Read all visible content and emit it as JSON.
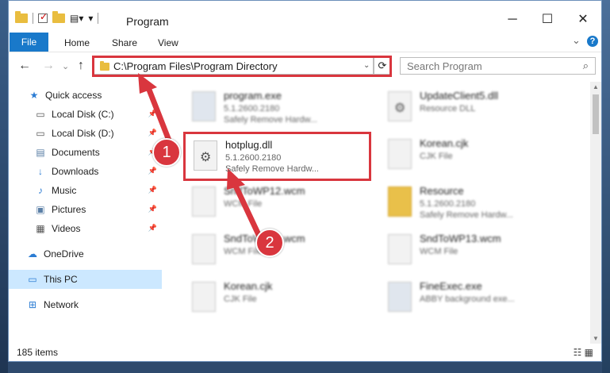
{
  "window": {
    "title": "Program",
    "min_label": "─",
    "max_label": "☐",
    "close_label": "✕"
  },
  "ribbon": {
    "file": "File",
    "home": "Home",
    "share": "Share",
    "view": "View",
    "expand": "⌄",
    "help": "?"
  },
  "address": {
    "path": "C:\\Program Files\\Program Directory",
    "search_placeholder": "Search Program",
    "back": "←",
    "forward": "→",
    "recent": "⌄",
    "up": "↑",
    "refresh": "⟳",
    "dropdown": "⌄",
    "search_icon": "⌕"
  },
  "sidebar": {
    "items": [
      {
        "label": "Quick access",
        "icon": "star-icon",
        "glyph": "★",
        "color": "#2b7cd3"
      },
      {
        "label": "Local Disk (C:)",
        "icon": "drive-icon",
        "glyph": "▭",
        "color": "#555555"
      },
      {
        "label": "Local Disk (D:)",
        "icon": "drive-icon",
        "glyph": "▭",
        "color": "#555555"
      },
      {
        "label": "Documents",
        "icon": "documents-icon",
        "glyph": "▤",
        "color": "#5b7fa6"
      },
      {
        "label": "Downloads",
        "icon": "download-icon",
        "glyph": "↓",
        "color": "#2b7cd3"
      },
      {
        "label": "Music",
        "icon": "music-icon",
        "glyph": "♪",
        "color": "#2b7cd3"
      },
      {
        "label": "Pictures",
        "icon": "pictures-icon",
        "glyph": "▣",
        "color": "#5b7fa6"
      },
      {
        "label": "Videos",
        "icon": "videos-icon",
        "glyph": "▦",
        "color": "#555555"
      },
      {
        "label": "OneDrive",
        "icon": "cloud-icon",
        "glyph": "☁",
        "color": "#2b7cd3"
      },
      {
        "label": "This PC",
        "icon": "computer-icon",
        "glyph": "▭",
        "color": "#2b7cd3"
      },
      {
        "label": "Network",
        "icon": "network-icon",
        "glyph": "⊞",
        "color": "#2b7cd3"
      }
    ],
    "pin_glyph": "📌"
  },
  "files": [
    {
      "name": "program.exe",
      "detail": "5.1.2600.2180",
      "type": "Safely Remove Hardw..."
    },
    {
      "name": "UpdateClient5.dll",
      "detail": "Resource DLL",
      "type": ""
    },
    {
      "name": "hotplug.dll",
      "detail": "5.1.2600.2180",
      "type": "Safely Remove Hardw..."
    },
    {
      "name": "Korean.cjk",
      "detail": "CJK File",
      "type": ""
    },
    {
      "name": "SndToWP12.wcm",
      "detail": "WCM File",
      "type": ""
    },
    {
      "name": "Resource",
      "detail": "5.1.2600.2180",
      "type": "Safely Remove Hardw..."
    },
    {
      "name": "SndToWP12.wcm",
      "detail": "WCM File",
      "type": ""
    },
    {
      "name": "SndToWP13.wcm",
      "detail": "WCM File",
      "type": ""
    },
    {
      "name": "Korean.cjk",
      "detail": "CJK File",
      "type": ""
    },
    {
      "name": "FineExec.exe",
      "detail": "ABBY background exe...",
      "type": ""
    }
  ],
  "gear_glyph": "⚙",
  "status": {
    "items": "185 items",
    "views": "☷ ▦"
  },
  "callouts": {
    "one": "1",
    "two": "2"
  },
  "colors": {
    "accent": "#1979ca",
    "callout": "#d9363e",
    "selection": "#cce8ff"
  }
}
